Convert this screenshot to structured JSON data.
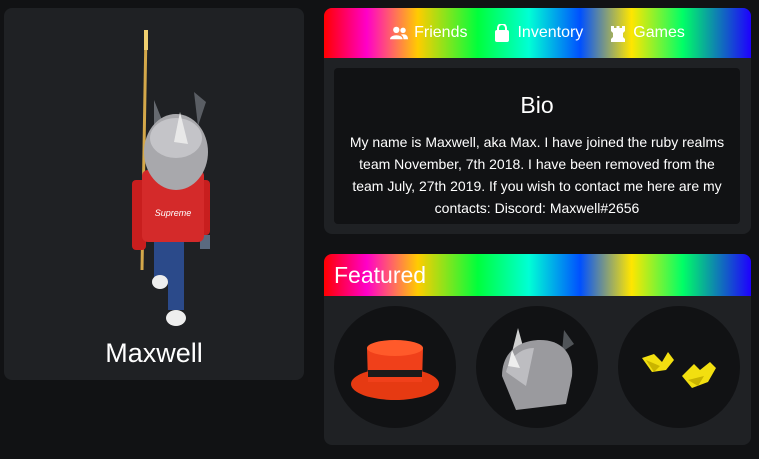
{
  "profile": {
    "username": "Maxwell",
    "shirt_text": "Supreme"
  },
  "nav": {
    "friends_label": "Friends",
    "inventory_label": "Inventory",
    "games_label": "Games"
  },
  "bio": {
    "title": "Bio",
    "text": "My name is Maxwell, aka Max. I have joined the ruby realms team November, 7th 2018. I have been removed from the team July, 27th 2019. If you wish to contact me here are my contacts: Discord: Maxwell#2656"
  },
  "featured": {
    "title": "Featured",
    "items": [
      {
        "icon": "red-top-hat-icon"
      },
      {
        "icon": "rhino-head-icon"
      },
      {
        "icon": "yellow-shoes-icon"
      }
    ]
  }
}
